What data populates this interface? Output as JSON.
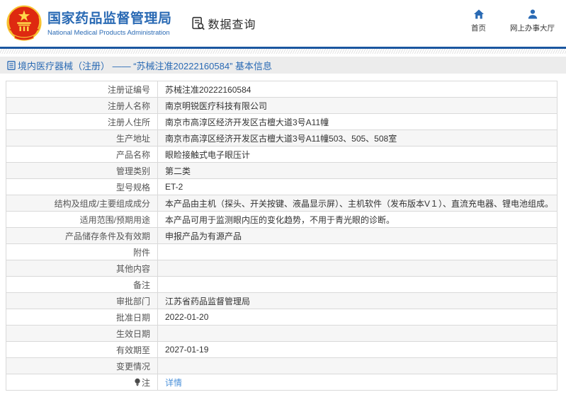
{
  "header": {
    "org_name_cn": "国家药品监督管理局",
    "org_name_en": "National Medical Products Administration",
    "module_title": "数据查询",
    "nav": [
      {
        "label": "首页",
        "icon": "home-icon"
      },
      {
        "label": "网上办事大厅",
        "icon": "person-icon"
      }
    ]
  },
  "breadcrumb": {
    "text": "境内医疗器械（注册） —— “苏械注准20222160584” 基本信息"
  },
  "table": {
    "rows": [
      {
        "label": "注册证编号",
        "value": "苏械注准20222160584"
      },
      {
        "label": "注册人名称",
        "value": "南京明锐医疗科技有限公司"
      },
      {
        "label": "注册人住所",
        "value": "南京市高淳区经济开发区古檀大道3号A11幢"
      },
      {
        "label": "生产地址",
        "value": "南京市高淳区经济开发区古檀大道3号A11幢503、505、508室"
      },
      {
        "label": "产品名称",
        "value": "眼睑接触式电子眼压计"
      },
      {
        "label": "管理类别",
        "value": "第二类"
      },
      {
        "label": "型号规格",
        "value": "ET-2"
      },
      {
        "label": "结构及组成/主要组成成分",
        "value": "本产品由主机（探头、开关按键、液晶显示屏）、主机软件（发布版本V１）、直流充电器、锂电池组成。"
      },
      {
        "label": "适用范围/预期用途",
        "value": "本产品可用于监测眼内压的变化趋势，不用于青光眼的诊断。"
      },
      {
        "label": "产品储存条件及有效期",
        "value": "申报产品为有源产品"
      },
      {
        "label": "附件",
        "value": ""
      },
      {
        "label": "其他内容",
        "value": ""
      },
      {
        "label": "备注",
        "value": ""
      },
      {
        "label": "审批部门",
        "value": "江苏省药品监督管理局"
      },
      {
        "label": "批准日期",
        "value": "2022-01-20"
      },
      {
        "label": "生效日期",
        "value": ""
      },
      {
        "label": "有效期至",
        "value": "2027-01-19"
      },
      {
        "label": "变更情况",
        "value": ""
      },
      {
        "label": "注",
        "value": "详情",
        "value_is_link": true,
        "label_icon": "lightbulb-icon"
      }
    ]
  },
  "colors": {
    "brand_blue": "#2a6ab4",
    "header_rule_blue": "#1b57a0",
    "breadcrumb_bg": "#ececec",
    "row_alt_bg": "#f6f6f6",
    "link_blue": "#4a90d9",
    "emblem_red": "#de2910",
    "emblem_gold": "#ffd94a"
  }
}
